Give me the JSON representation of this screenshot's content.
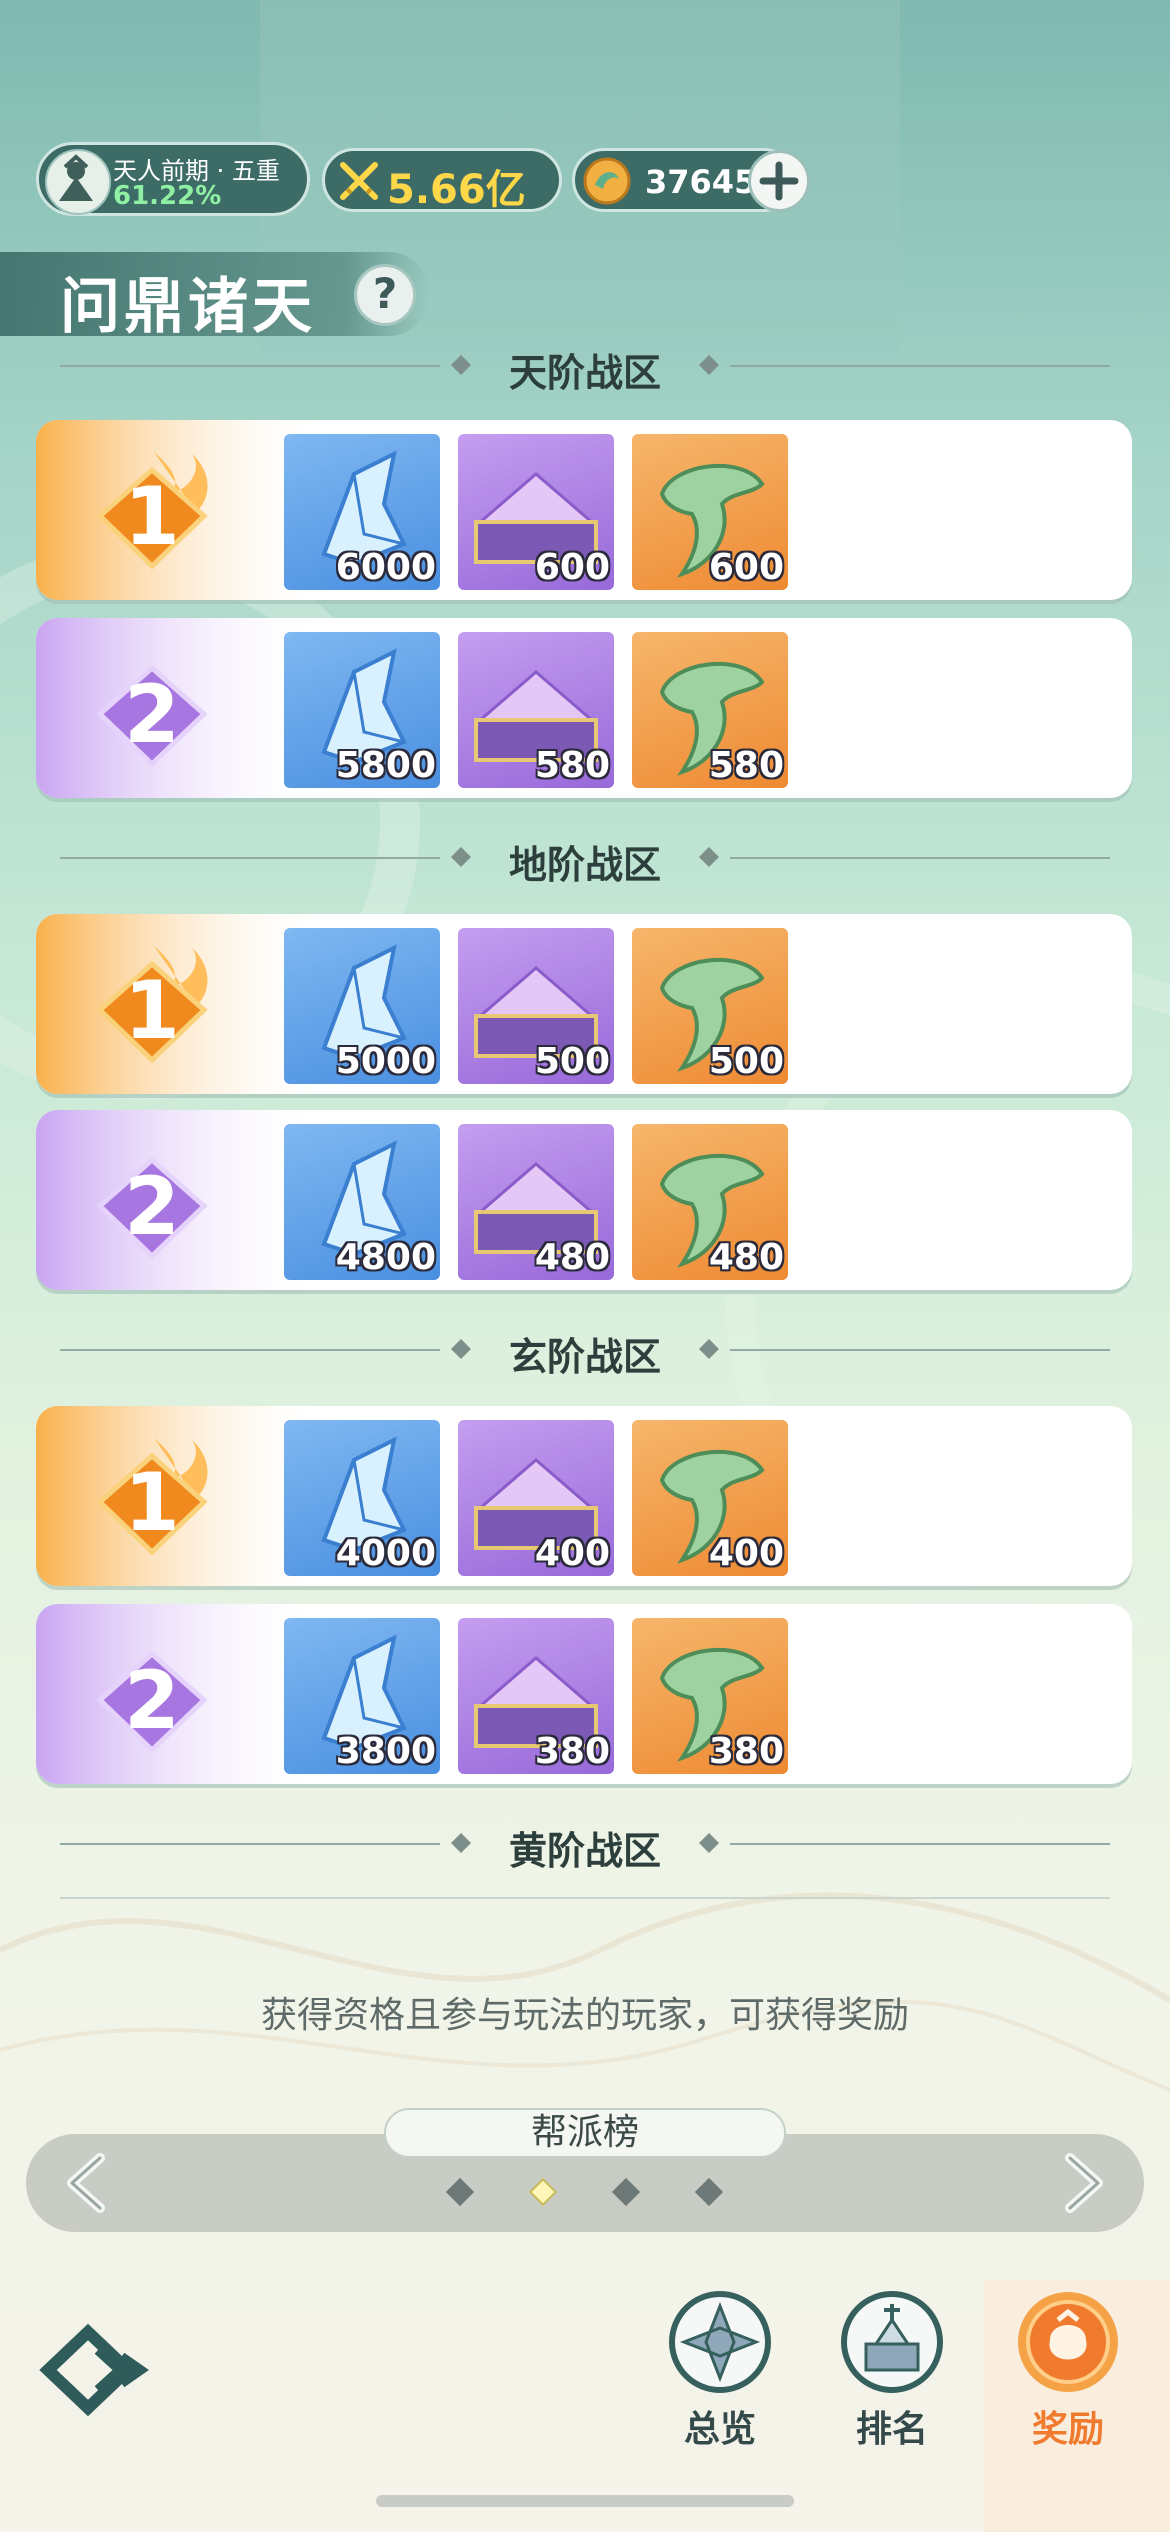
{
  "header": {
    "realm_name": "天人前期 · 五重",
    "realm_progress": "61.22%",
    "power": "5.66亿",
    "currency": "37645"
  },
  "title": "问鼎诸天",
  "sections": [
    {
      "name": "天阶战区",
      "rows": [
        {
          "rank": "1",
          "items": [
            "6000",
            "600",
            "600"
          ]
        },
        {
          "rank": "2",
          "items": [
            "5800",
            "580",
            "580"
          ]
        }
      ]
    },
    {
      "name": "地阶战区",
      "rows": [
        {
          "rank": "1",
          "items": [
            "5000",
            "500",
            "500"
          ]
        },
        {
          "rank": "2",
          "items": [
            "4800",
            "480",
            "480"
          ]
        }
      ]
    },
    {
      "name": "玄阶战区",
      "rows": [
        {
          "rank": "1",
          "items": [
            "4000",
            "400",
            "400"
          ]
        },
        {
          "rank": "2",
          "items": [
            "3800",
            "380",
            "380"
          ]
        }
      ]
    },
    {
      "name": "黄阶战区",
      "rows": []
    }
  ],
  "item_icons": [
    "crystal-icon",
    "purple-treasure-chest-icon",
    "jade-claw-icon"
  ],
  "hint": "获得资格且参与玩法的玩家，可获得奖励",
  "tab": {
    "label": "帮派榜",
    "page_count": 4,
    "active_index": 1
  },
  "nav": [
    {
      "label": "总览",
      "icon": "overview-icon",
      "active": false
    },
    {
      "label": "排名",
      "icon": "ranking-icon",
      "active": false
    },
    {
      "label": "奖励",
      "icon": "reward-icon",
      "active": true
    }
  ],
  "colors": {
    "active_nav": "#f07a2e",
    "inactive_nav": "#34494a",
    "rank1": "#f59a36",
    "rank2": "#a776e0"
  }
}
